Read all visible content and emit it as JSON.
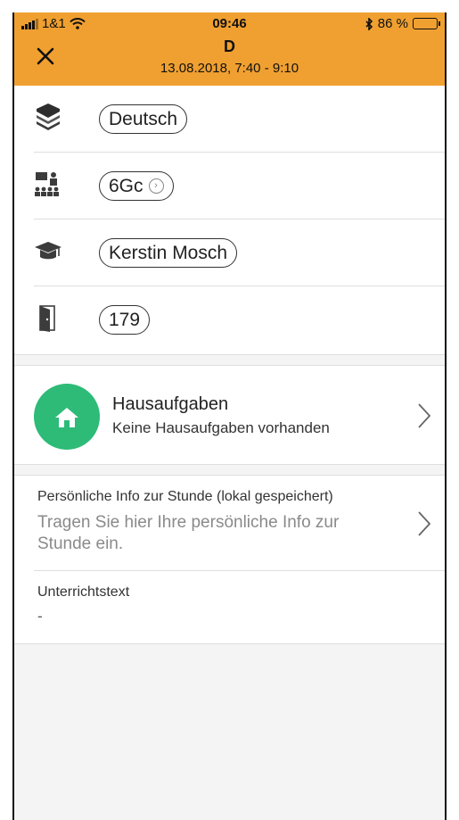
{
  "status_bar": {
    "carrier": "1&1",
    "time": "09:46",
    "battery_text": "86 %",
    "battery_level": 0.86
  },
  "header": {
    "title": "D",
    "subtitle": "13.08.2018, 7:40 - 9:10",
    "color": "#f0a030"
  },
  "details": [
    {
      "icon": "books-icon",
      "value": "Deutsch"
    },
    {
      "icon": "class-icon",
      "value": "6Gc"
    },
    {
      "icon": "graduation-cap-icon",
      "value": "Kerstin Mosch"
    },
    {
      "icon": "door-icon",
      "value": "179"
    }
  ],
  "homework": {
    "title": "Hausaufgaben",
    "subtitle": "Keine Hausaufgaben vorhanden",
    "icon": "house-icon",
    "color": "#2dbb77"
  },
  "personal_info": {
    "label": "Persönliche Info zur Stunde (lokal gespeichert)",
    "placeholder": "Tragen Sie hier Ihre persönliche Info zur Stunde ein."
  },
  "lesson_text": {
    "label": "Unterrichtstext",
    "value": "-"
  }
}
